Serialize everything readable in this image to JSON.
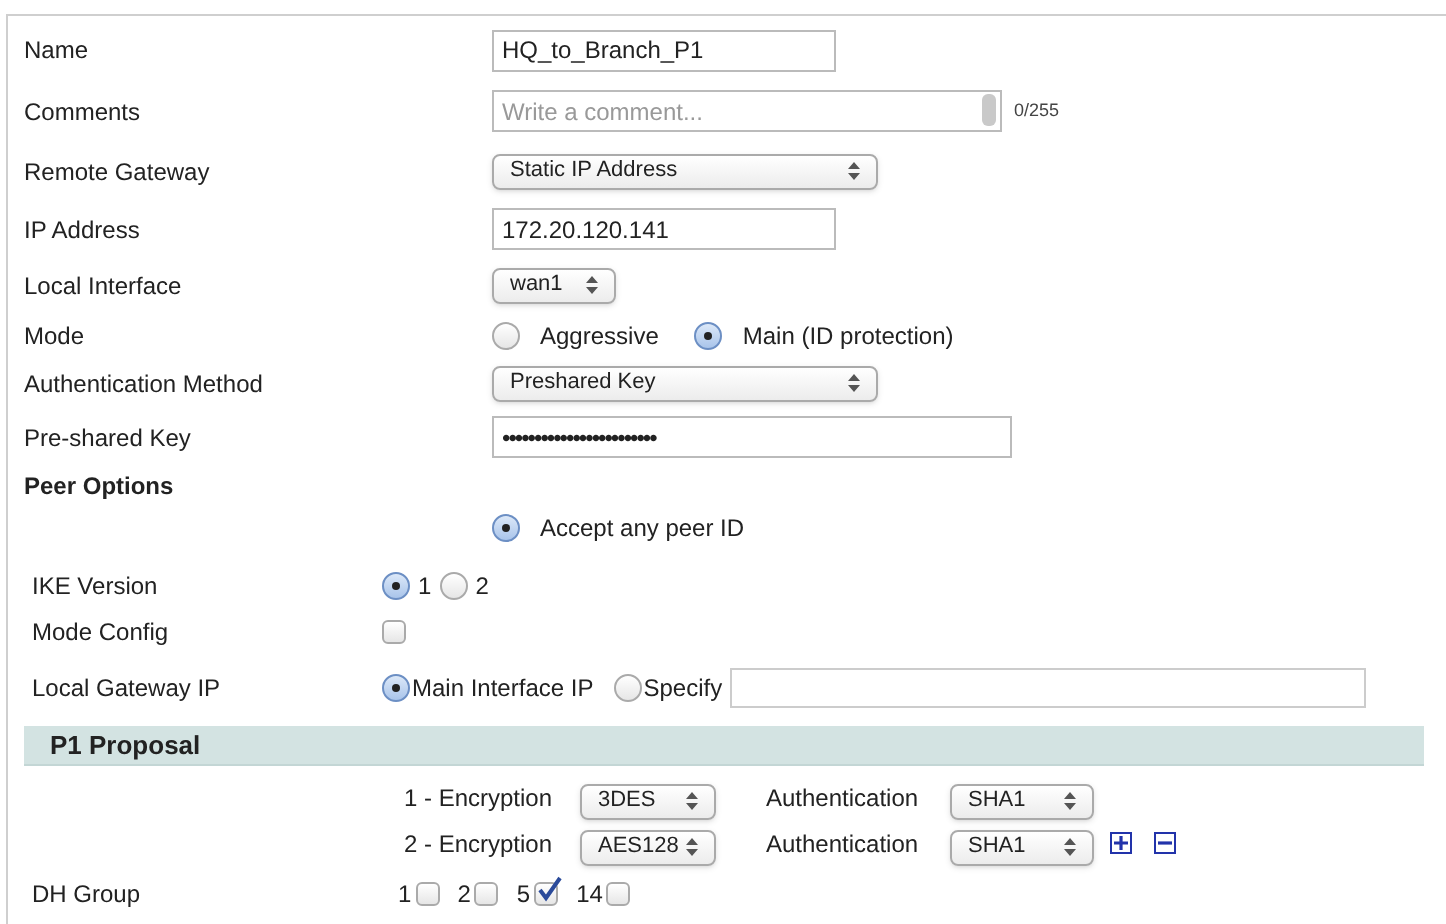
{
  "fields": [
    {
      "kind": "text",
      "label": "Name",
      "value": "HQ_to_Branch_P1"
    },
    {
      "kind": "comment",
      "label": "Comments",
      "placeholder": "Write a comment...",
      "counter": "0/255"
    },
    {
      "kind": "select",
      "label": "Remote Gateway",
      "value": "Static IP Address"
    },
    {
      "kind": "text",
      "label": "IP Address",
      "value": "172.20.120.141"
    },
    {
      "kind": "select_small",
      "label": "Local Interface",
      "value": "wan1"
    },
    {
      "kind": "radio",
      "label": "Mode",
      "options": [
        {
          "label": "Aggressive",
          "selected": false
        },
        {
          "label": "Main (ID protection)",
          "selected": true
        }
      ]
    },
    {
      "kind": "select",
      "label": "Authentication Method",
      "value": "Preshared Key"
    },
    {
      "kind": "password",
      "label": "Pre-shared Key",
      "value": "••••••••••••••••••••••••"
    }
  ],
  "peer_options": {
    "title": "Peer Options",
    "options": [
      {
        "label": "Accept any peer ID",
        "selected": true
      }
    ]
  },
  "settings": [
    {
      "kind": "radio",
      "label": "IKE Version",
      "options": [
        {
          "label": "1",
          "selected": true
        },
        {
          "label": "2",
          "selected": false
        }
      ]
    },
    {
      "kind": "checkbox",
      "label": "Mode Config",
      "checked": false
    },
    {
      "kind": "radio_field",
      "label": "Local Gateway IP",
      "options": [
        {
          "label": "Main Interface IP",
          "selected": true
        },
        {
          "label": "Specify",
          "selected": false
        }
      ]
    }
  ],
  "p1_proposal": {
    "title": "P1 Proposal",
    "proposals": [
      {
        "encryption_label": "1 - Encryption",
        "encryption": "3DES",
        "authentication_label": "Authentication",
        "authentication": "SHA1",
        "add_remove": false
      },
      {
        "encryption_label": "2 - Encryption",
        "encryption": "AES128",
        "authentication_label": "Authentication",
        "authentication": "SHA1",
        "add_remove": true
      }
    ],
    "dh_group": {
      "label": "DH Group",
      "options": [
        {
          "label": "1",
          "checked": false
        },
        {
          "label": "2",
          "checked": false
        },
        {
          "label": "5",
          "checked": true
        },
        {
          "label": "14",
          "checked": false
        }
      ]
    }
  }
}
